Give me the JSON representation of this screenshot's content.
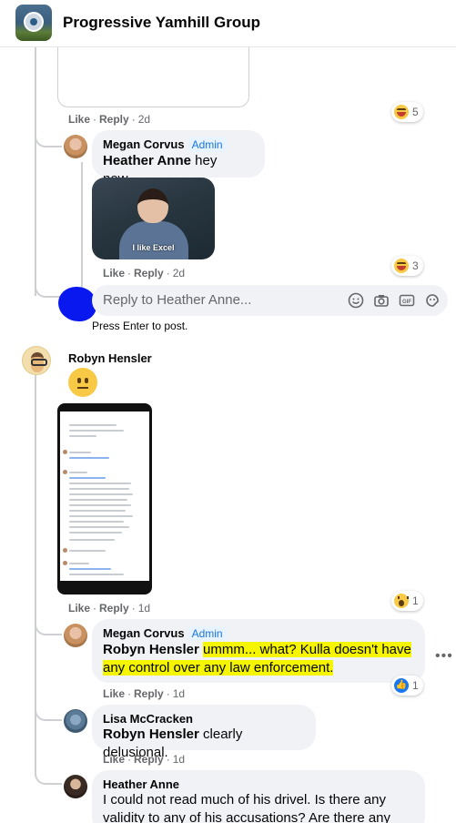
{
  "header": {
    "group_name": "Progressive Yamhill Group"
  },
  "comments": {
    "top": {
      "actions": {
        "like": "Like",
        "reply": "Reply",
        "time": "2d"
      },
      "reaction_count": "5"
    },
    "megan_1": {
      "author": "Megan Corvus",
      "badge": "Admin",
      "mention": "Heather Anne",
      "text": "hey now...",
      "gif_caption": "I like Excel",
      "actions": {
        "like": "Like",
        "reply": "Reply",
        "time": "2d"
      },
      "reaction_count": "3"
    },
    "reply_box": {
      "placeholder": "Reply to Heather Anne...",
      "hint": "Press Enter to post."
    },
    "robyn": {
      "author": "Robyn Hensler",
      "actions": {
        "like": "Like",
        "reply": "Reply",
        "time": "1d"
      },
      "reaction_count": "1"
    },
    "megan_2": {
      "author": "Megan Corvus",
      "badge": "Admin",
      "mention": "Robyn Hensler",
      "text_highlight_1": "ummm... what? Kulla doesn't have",
      "text_highlight_2": "any control over any law enforcement.",
      "actions": {
        "like": "Like",
        "reply": "Reply",
        "time": "1d"
      },
      "reaction_count": "1"
    },
    "lisa": {
      "author": "Lisa McCracken",
      "mention": "Robyn Hensler",
      "text": "clearly delusional.",
      "actions": {
        "like": "Like",
        "reply": "Reply",
        "time": "1d"
      }
    },
    "heather": {
      "author": "Heather Anne",
      "text_line1": "I could not read much of his drivel. Is there any",
      "text_line2": "validity to any of his accusations? Are there any"
    }
  },
  "colors": {
    "link_blue": "#1b74e4",
    "highlight": "#f5f500",
    "bubble": "#f0f2f5"
  }
}
